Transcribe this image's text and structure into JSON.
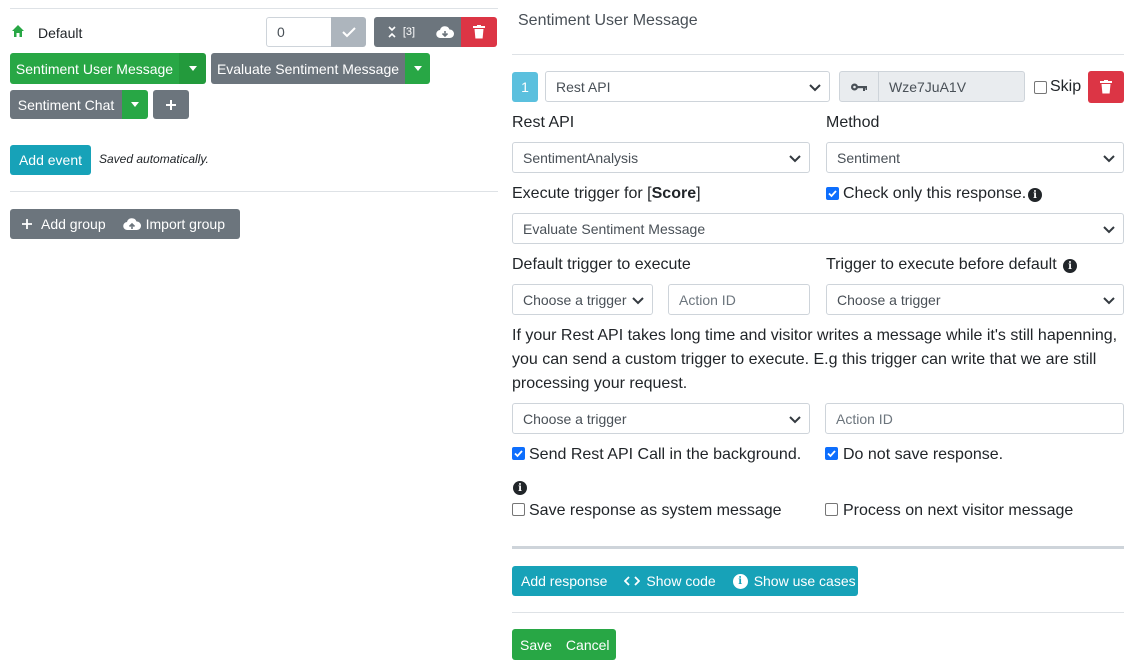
{
  "left": {
    "group_name": "Default",
    "priority_value": "0",
    "collapse_count": "[3]",
    "triggers": [
      {
        "label": "Sentiment User Message"
      },
      {
        "label": "Evaluate Sentiment Message"
      },
      {
        "label": "Sentiment Chat"
      }
    ],
    "add_event_label": "Add event",
    "saved_note": "Saved automatically.",
    "add_group_label": "Add group",
    "import_group_label": "Import group"
  },
  "right": {
    "title": "Sentiment User Message",
    "step_number": "1",
    "type_select": "Rest API",
    "key_value": "Wze7JuA1V",
    "skip_label": "Skip",
    "rest_api_label": "Rest API",
    "rest_api_select": "SentimentAnalysis",
    "method_label": "Method",
    "method_select": "Sentiment",
    "execute_trigger_prefix": "Execute trigger for [",
    "execute_trigger_param": "Score",
    "execute_trigger_suffix": "]",
    "check_only_label": "Check only this response.",
    "execute_trigger_select": "Evaluate Sentiment Message",
    "default_trigger_label": "Default trigger to execute",
    "before_default_label": "Trigger to execute before default",
    "choose_trigger": "Choose a trigger",
    "action_id_placeholder": "Action ID",
    "long_time_note": "If your Rest API takes long time and visitor writes a message while it's still hapenning, you can send a custom trigger to execute. E.g this trigger can write that we are still processing your request.",
    "send_background_label": "Send Rest API Call in the background.",
    "do_not_save_label": "Do not save response.",
    "save_system_label": "Save response as system message",
    "process_next_label": "Process on next visitor message",
    "add_response_label": "Add response",
    "show_code_label": "Show code",
    "show_use_cases_label": "Show use cases",
    "save_label": "Save",
    "cancel_label": "Cancel"
  },
  "colors": {
    "green": "#28a745",
    "gray": "#6c757d",
    "teal": "#17a2b8",
    "red": "#dc3545",
    "checkbox_blue": "#0d6efd"
  },
  "icons": [
    "home-icon",
    "check-icon",
    "collapse-icon",
    "cloud-download-icon",
    "trash-icon",
    "caret-down-icon",
    "plus-icon",
    "cloud-upload-icon",
    "key-icon",
    "chevron-down-icon",
    "code-icon",
    "info-icon"
  ]
}
